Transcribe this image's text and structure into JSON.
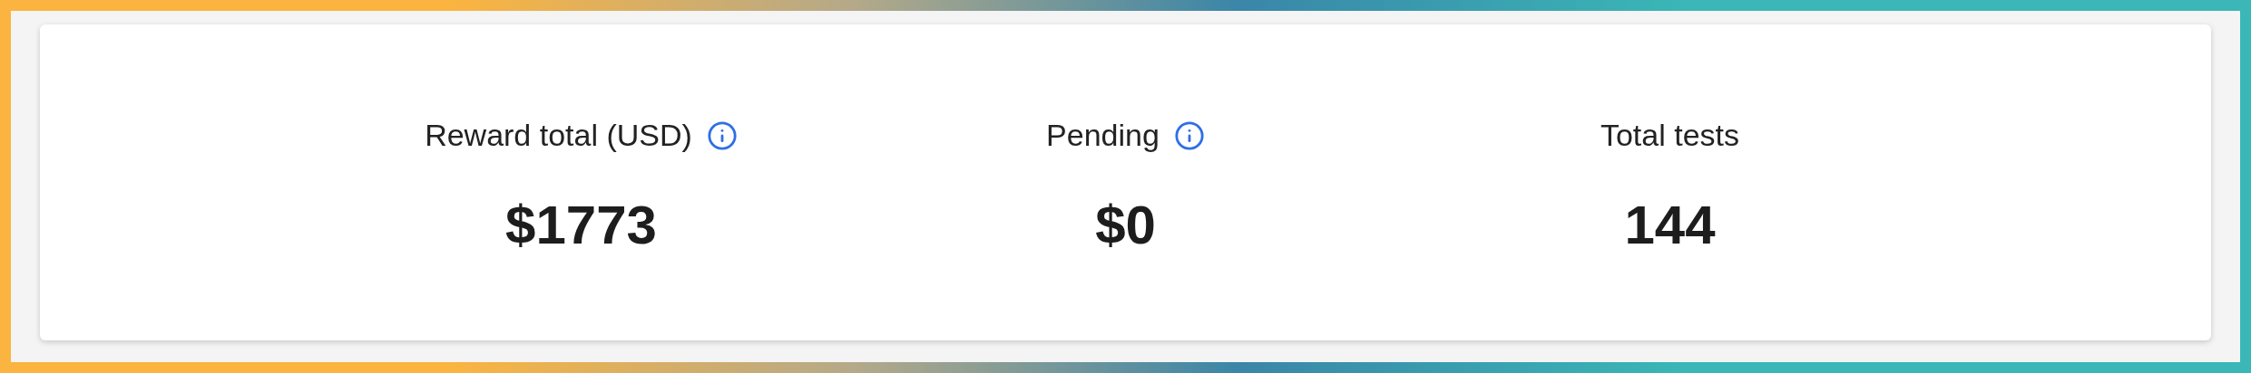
{
  "stats": [
    {
      "label": "Reward total (USD)",
      "value": "$1773",
      "info": true
    },
    {
      "label": "Pending",
      "value": "$0",
      "info": true
    },
    {
      "label": "Total tests",
      "value": "144",
      "info": false
    }
  ]
}
